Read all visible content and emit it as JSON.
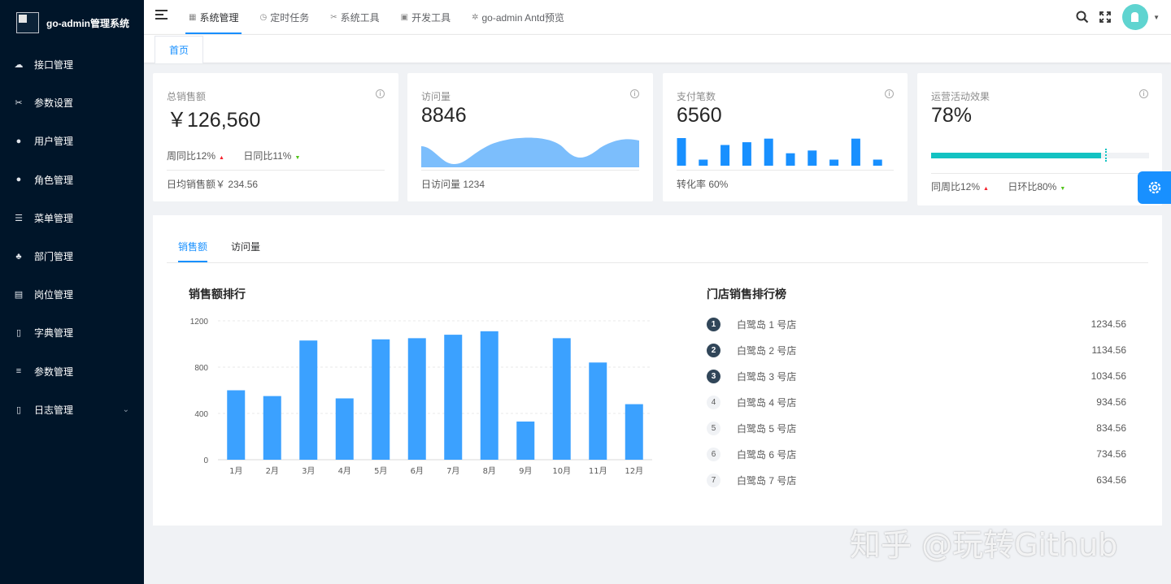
{
  "app": {
    "title": "go-admin管理系统"
  },
  "sidebar": {
    "items": [
      {
        "label": "接口管理",
        "icon": "cloud-icon"
      },
      {
        "label": "参数设置",
        "icon": "tools-icon"
      },
      {
        "label": "用户管理",
        "icon": "user-icon"
      },
      {
        "label": "角色管理",
        "icon": "users-icon"
      },
      {
        "label": "菜单管理",
        "icon": "tree-list-icon"
      },
      {
        "label": "部门管理",
        "icon": "org-chart-icon"
      },
      {
        "label": "岗位管理",
        "icon": "building-icon"
      },
      {
        "label": "字典管理",
        "icon": "book-icon"
      },
      {
        "label": "参数管理",
        "icon": "sliders-icon"
      },
      {
        "label": "日志管理",
        "icon": "document-icon"
      }
    ]
  },
  "navbar": {
    "tabs": [
      {
        "label": "系统管理",
        "icon": "grid-icon",
        "active": true
      },
      {
        "label": "定时任务",
        "icon": "clock-icon",
        "active": false
      },
      {
        "label": "系统工具",
        "icon": "tools-icon",
        "active": false
      },
      {
        "label": "开发工具",
        "icon": "package-icon",
        "active": false
      },
      {
        "label": "go-admin Antd预览",
        "icon": "bug-icon",
        "active": false
      }
    ]
  },
  "tagsview": {
    "home": "首页"
  },
  "cards": {
    "sales": {
      "title": "总销售额",
      "value": "￥126,560",
      "week": "周同比12%",
      "day": "日同比11%",
      "foot": "日均销售额￥ 234.56"
    },
    "visits": {
      "title": "访问量",
      "value": "8846",
      "foot": "日访问量 1234"
    },
    "payments": {
      "title": "支付笔数",
      "value": "6560",
      "foot": "转化率 60%"
    },
    "ops": {
      "title": "运营活动效果",
      "value": "78%",
      "progress": 0.78,
      "week": "同周比12%",
      "day": "日环比80%"
    }
  },
  "panel": {
    "tabs": [
      "销售额",
      "访问量"
    ],
    "chart_title": "销售额排行",
    "ranking_title": "门店销售排行榜",
    "ranking": [
      {
        "rank": "1",
        "name": "白鹭岛 1 号店",
        "value": "1234.56"
      },
      {
        "rank": "2",
        "name": "白鹭岛 2 号店",
        "value": "1134.56"
      },
      {
        "rank": "3",
        "name": "白鹭岛 3 号店",
        "value": "1034.56"
      },
      {
        "rank": "4",
        "name": "白鹭岛 4 号店",
        "value": "934.56"
      },
      {
        "rank": "5",
        "name": "白鹭岛 5 号店",
        "value": "834.56"
      },
      {
        "rank": "6",
        "name": "白鹭岛 6 号店",
        "value": "734.56"
      },
      {
        "rank": "7",
        "name": "白鹭岛 7 号店",
        "value": "634.56"
      }
    ]
  },
  "chart_data": {
    "type": "bar",
    "categories": [
      "1月",
      "2月",
      "3月",
      "4月",
      "5月",
      "6月",
      "7月",
      "8月",
      "9月",
      "10月",
      "11月",
      "12月"
    ],
    "values": [
      600,
      550,
      1030,
      530,
      1040,
      1050,
      1080,
      1110,
      330,
      1050,
      840,
      480
    ],
    "yticks": [
      0,
      400,
      800,
      1200
    ],
    "ylim": [
      0,
      1200
    ],
    "color": "#3ba1ff"
  },
  "sparkline_bars": {
    "values": [
      1.0,
      0.22,
      0.75,
      0.85,
      0.98,
      0.45,
      0.55,
      0.22,
      0.98,
      0.22
    ]
  },
  "colors": {
    "primary": "#1890ff",
    "sidebar": "#001529",
    "progress": "#13c2c2",
    "area": "#7cbefc"
  },
  "watermark": "知乎 @玩转Github"
}
